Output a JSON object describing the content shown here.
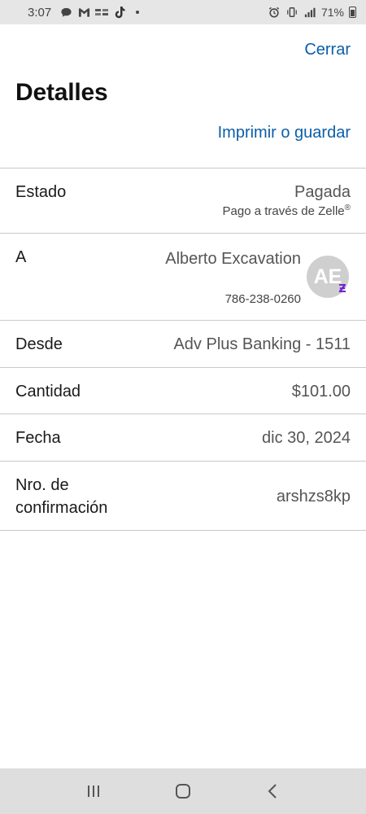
{
  "status_bar": {
    "time": "3:07",
    "battery": "71%",
    "icons": [
      "chat-icon",
      "gmail-icon",
      "app-icon",
      "app-icon",
      "tiktok-icon",
      "dot-icon",
      "alarm-icon",
      "vibrate-icon",
      "signal-icon",
      "battery-icon"
    ]
  },
  "header": {
    "close_label": "Cerrar",
    "title": "Detalles",
    "print_label": "Imprimir o guardar"
  },
  "details": {
    "status": {
      "label": "Estado",
      "value": "Pagada",
      "sub": "Pago a través de Zelle",
      "sub_mark": "®"
    },
    "to": {
      "label": "A",
      "name": "Alberto Excavation",
      "phone": "786-238-0260",
      "initials": "AE",
      "badge": "Ƶ"
    },
    "from": {
      "label": "Desde",
      "value": "Adv Plus Banking - 1511"
    },
    "amount": {
      "label": "Cantidad",
      "value": "$101.00"
    },
    "date": {
      "label": "Fecha",
      "value": "dic 30, 2024"
    },
    "confirmation": {
      "label_line1": "Nro. de",
      "label_line2": "confirmación",
      "value": "arshzs8kp"
    }
  },
  "colors": {
    "link": "#0b5ea8",
    "divider": "#c9c9c9",
    "zelle": "#6d1ed4"
  },
  "nav": {
    "icons": [
      "recent-apps-icon",
      "home-icon",
      "back-icon"
    ]
  }
}
